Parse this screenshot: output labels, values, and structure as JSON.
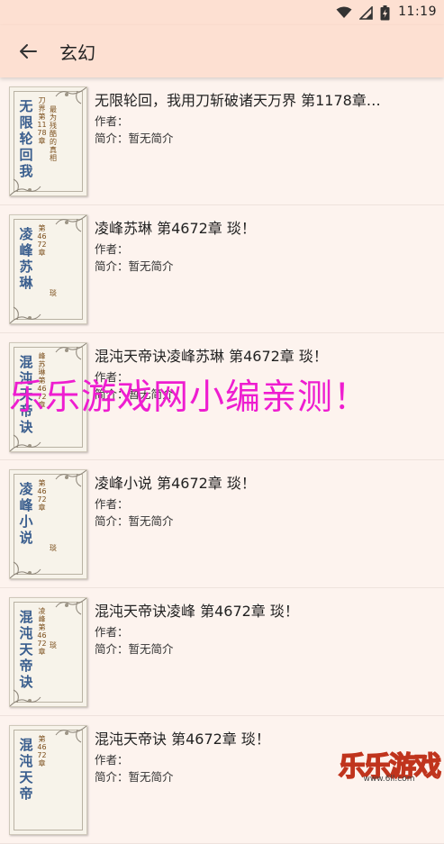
{
  "status_bar": {
    "time": "11:19"
  },
  "app_bar": {
    "title": "玄幻"
  },
  "books": [
    {
      "title": "无限轮回，我用刀斩破诸天万界 第1178章…",
      "author_label": "作者：",
      "intro_label": "简介：暂无简介",
      "cover_title": "无限轮回我",
      "cover_chapter": "刀界第1178章",
      "cover_chapter2": "最为残酷的真相"
    },
    {
      "title": "凌峰苏琳 第4672章 琰！",
      "author_label": "作者：",
      "intro_label": "简介：暂无简介",
      "cover_title": "凌峰苏琳",
      "cover_chapter": "第4672章",
      "cover_chapter2": "琰"
    },
    {
      "title": "混沌天帝诀凌峰苏琳 第4672章 琰！",
      "author_label": "作者：",
      "intro_label": "简介：暂无简介",
      "cover_title": "混沌天帝诀",
      "cover_chapter": "峰苏琳第4672章",
      "cover_chapter2": ""
    },
    {
      "title": "凌峰小说 第4672章 琰！",
      "author_label": "作者：",
      "intro_label": "简介：暂无简介",
      "cover_title": "凌峰小说",
      "cover_chapter": "第4672章",
      "cover_chapter2": "琰"
    },
    {
      "title": "混沌天帝诀凌峰 第4672章 琰！",
      "author_label": "作者：",
      "intro_label": "简介：暂无简介",
      "cover_title": "混沌天帝诀",
      "cover_chapter": "凌峰第4672章",
      "cover_chapter2": "琰"
    },
    {
      "title": "混沌天帝诀 第4672章 琰！",
      "author_label": "作者：",
      "intro_label": "简介：暂无简介",
      "cover_title": "混沌天帝",
      "cover_chapter": "第4672章",
      "cover_chapter2": ""
    }
  ],
  "watermark": {
    "text": "乐乐游戏网小编亲测！"
  },
  "logo": {
    "text": "乐乐游戏",
    "url": "www.6ll.com"
  },
  "colors": {
    "appbar_bg": "#fde0d2",
    "page_bg": "#fdf3ee",
    "watermark": "#ee1dd0",
    "cover_title": "#3a5e8e"
  },
  "icons": [
    "wifi-icon",
    "signal-icon",
    "battery-icon",
    "back-arrow-icon"
  ]
}
